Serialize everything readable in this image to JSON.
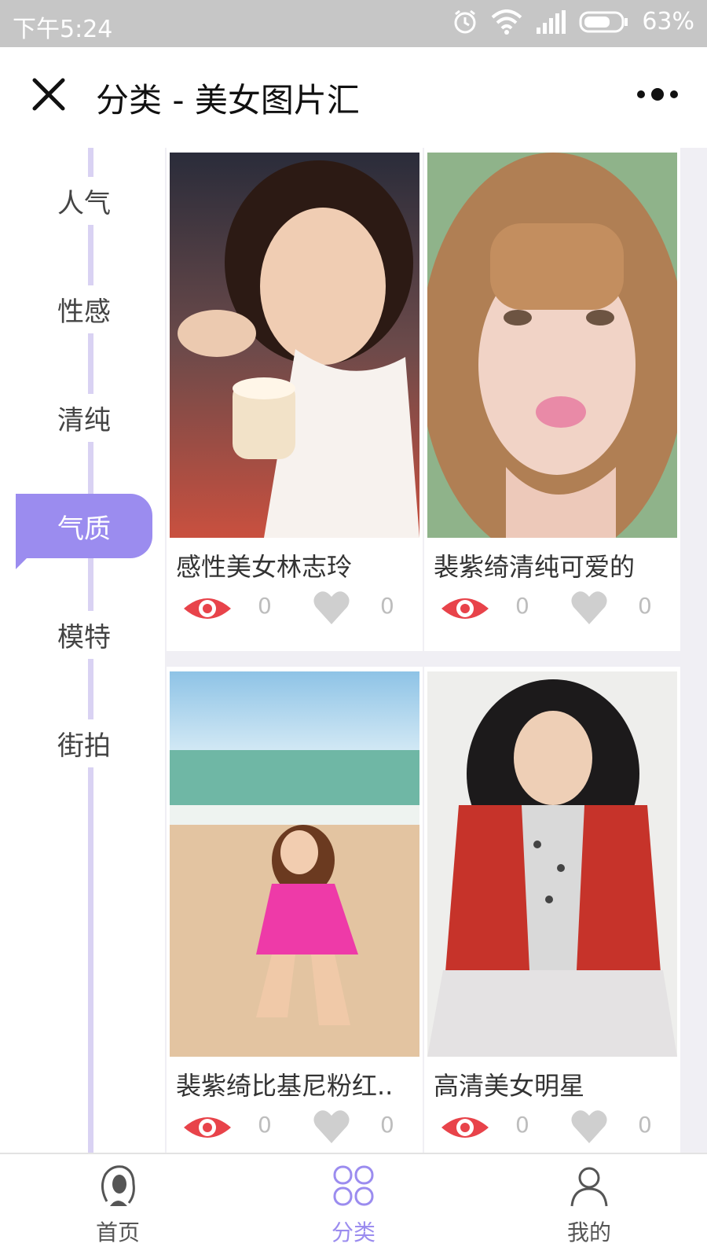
{
  "status_bar": {
    "time": "下午5:24",
    "battery": "63%"
  },
  "header": {
    "title": "分类 - 美女图片汇",
    "close_icon": "close-icon",
    "more_icon": "more-icon"
  },
  "sidebar": {
    "items": [
      {
        "label": "人气"
      },
      {
        "label": "性感"
      },
      {
        "label": "清纯"
      },
      {
        "label": "气质",
        "active": true
      },
      {
        "label": "模特"
      },
      {
        "label": "街拍"
      }
    ]
  },
  "cards": [
    {
      "title": "感性美女林志玲",
      "views": "0",
      "likes": "0"
    },
    {
      "title": "裴紫绮清纯可爱的",
      "views": "0",
      "likes": "0"
    },
    {
      "title": "裴紫绮比基尼粉红..",
      "views": "0",
      "likes": "0"
    },
    {
      "title": "高清美女明星",
      "views": "0",
      "likes": "0"
    }
  ],
  "tabbar": {
    "items": [
      {
        "label": "首页",
        "icon": "home-portrait-icon"
      },
      {
        "label": "分类",
        "icon": "category-grid-icon",
        "active": true
      },
      {
        "label": "我的",
        "icon": "user-icon"
      }
    ]
  },
  "colors": {
    "accent": "#9b8cef",
    "eye": "#e8434a",
    "heart": "#cfcfcf",
    "rail": "#d9d2f3"
  }
}
